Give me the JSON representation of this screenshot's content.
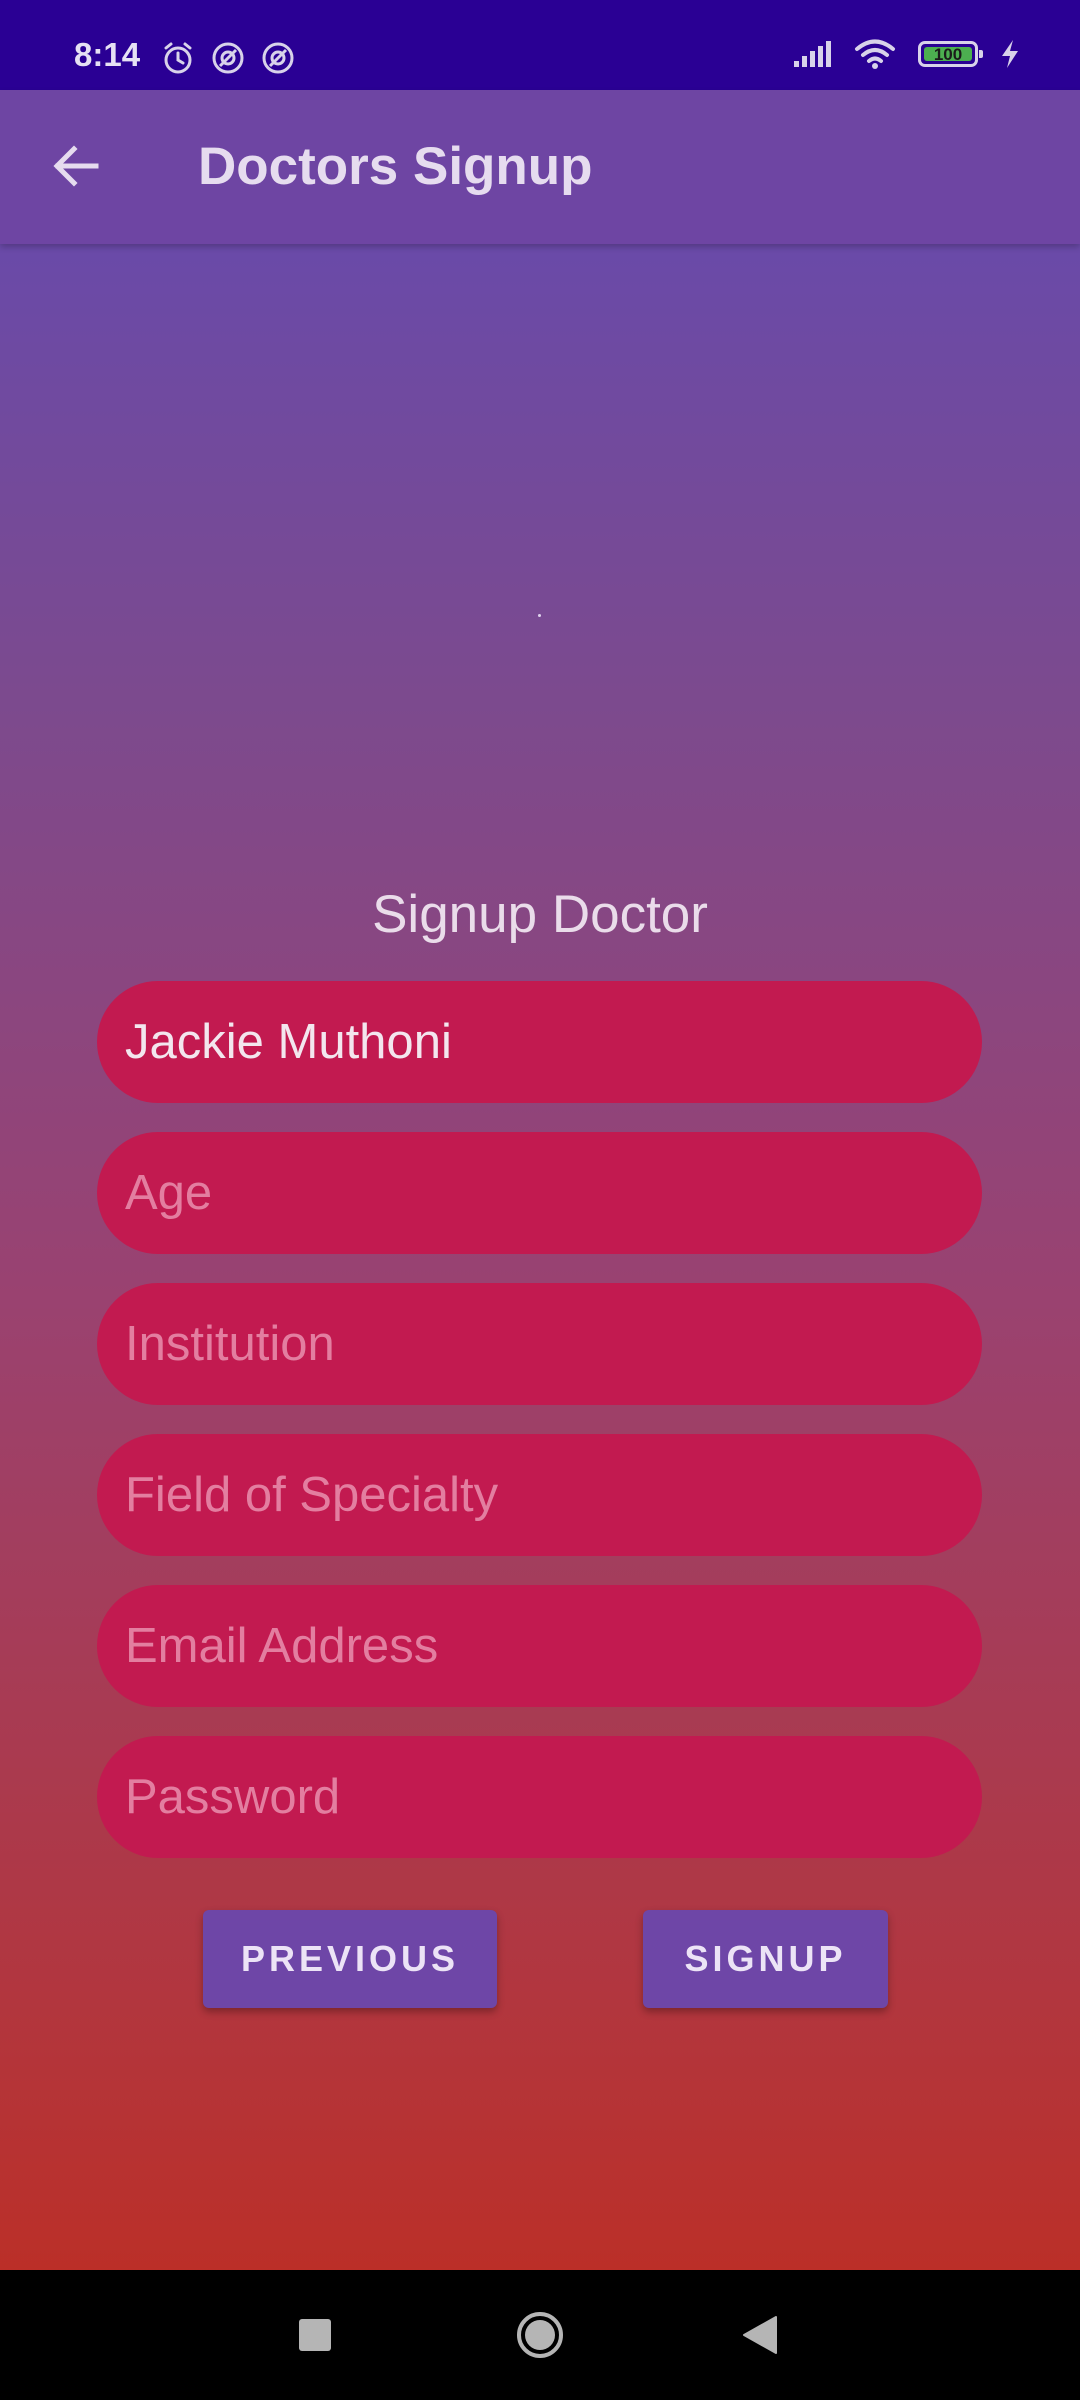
{
  "status_bar": {
    "time": "8:14",
    "left_icons": [
      "alarm-icon",
      "notification-icon",
      "notification-icon"
    ],
    "right_icons": [
      "signal-icon",
      "wifi-icon",
      "battery-icon",
      "charging-icon"
    ],
    "battery_level": "100"
  },
  "app_bar": {
    "title": "Doctors Signup",
    "back_icon": "arrow-back-icon"
  },
  "form": {
    "title": "Signup Doctor",
    "fields": [
      {
        "name": "name",
        "value": "Jackie Muthoni",
        "placeholder": ""
      },
      {
        "name": "age",
        "value": "",
        "placeholder": "Age"
      },
      {
        "name": "institution",
        "value": "",
        "placeholder": "Institution"
      },
      {
        "name": "specialty",
        "value": "",
        "placeholder": "Field of Specialty"
      },
      {
        "name": "email",
        "value": "",
        "placeholder": "Email Address"
      },
      {
        "name": "password",
        "value": "",
        "placeholder": "Password"
      }
    ],
    "previous_label": "PREVIOUS",
    "signup_label": "SIGNUP"
  },
  "nav_bar": {
    "buttons": [
      "recents-square-icon",
      "home-circle-icon",
      "back-triangle-icon"
    ]
  },
  "colors": {
    "status_bar": "#2a0094",
    "app_bar": "#6e45a3",
    "field": "#c21a50",
    "button": "#6e46a7"
  }
}
